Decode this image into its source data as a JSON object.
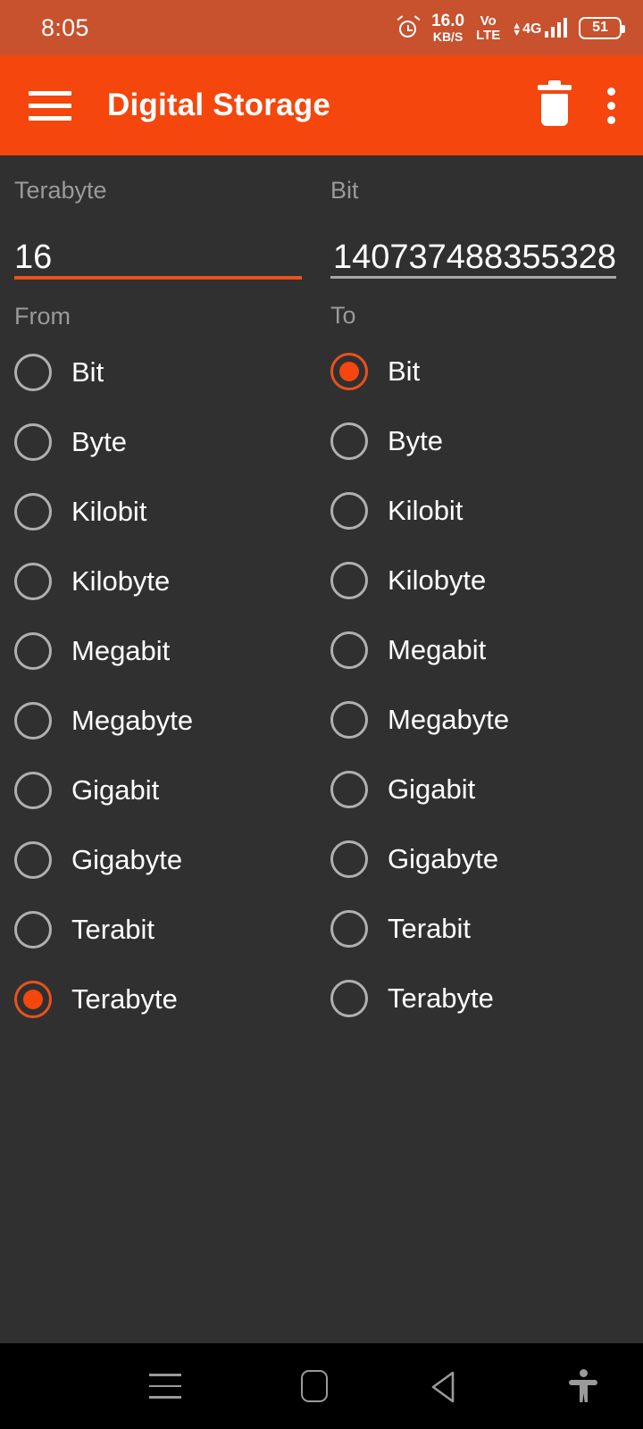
{
  "status_bar": {
    "clock": "8:05",
    "alarm_icon": "alarm-icon",
    "network_speed_value": "16.0",
    "network_speed_unit": "KB/S",
    "volte_line1": "Vo",
    "volte_line2": "LTE",
    "data_network": "4G",
    "signal_icon": "signal-bars-icon",
    "battery_level": "51",
    "background_color": "#c8512e"
  },
  "app_bar": {
    "menu_icon": "hamburger-menu-icon",
    "title": "Digital Storage",
    "delete_icon": "trash-icon",
    "overflow_icon": "kebab-menu-icon",
    "background_color": "#f4460d"
  },
  "converter": {
    "input": {
      "label": "Terabyte",
      "value": "16",
      "placeholder": "",
      "underline_color": "#e8521f",
      "focused": true
    },
    "output": {
      "label": "Bit",
      "value": "140737488355328",
      "placeholder": "",
      "underline_color": "#a8a8a8",
      "focused": false
    },
    "from": {
      "label": "From",
      "selected": "Terabyte",
      "options": [
        "Bit",
        "Byte",
        "Kilobit",
        "Kilobyte",
        "Megabit",
        "Megabyte",
        "Gigabit",
        "Gigabyte",
        "Terabit",
        "Terabyte"
      ]
    },
    "to": {
      "label": "To",
      "selected": "Bit",
      "options": [
        "Bit",
        "Byte",
        "Kilobit",
        "Kilobyte",
        "Megabit",
        "Megabyte",
        "Gigabit",
        "Gigabyte",
        "Terabit",
        "Terabyte"
      ]
    },
    "accent_color": "#f4460d",
    "background_color": "#303030"
  },
  "nav_bar": {
    "recents_icon": "recents-icon",
    "home_icon": "home-icon",
    "back_icon": "back-icon",
    "accessibility_icon": "accessibility-icon",
    "background_color": "#000000"
  }
}
